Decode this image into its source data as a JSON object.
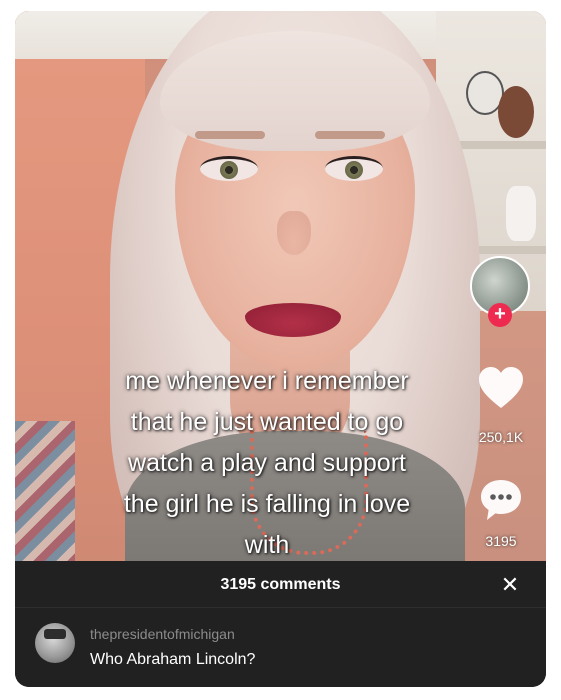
{
  "video": {
    "caption_lines": [
      "me whenever i remember",
      "that he just wanted to go",
      "watch a play and support",
      "the girl he is falling in love",
      "with"
    ]
  },
  "actions": {
    "follow_symbol": "+",
    "like_count": "250,1K",
    "comment_count": "3195",
    "icons": {
      "like": "heart-icon",
      "comment": "speech-bubble-icon",
      "follow": "plus-icon",
      "close": "close-icon"
    }
  },
  "comments_panel": {
    "title": "3195 comments",
    "close_symbol": "✕",
    "comments": [
      {
        "username": "thepresidentofmichigan",
        "text": "Who Abraham Lincoln?"
      }
    ]
  },
  "colors": {
    "accent_follow": "#ee2a50",
    "panel_bg": "#212121",
    "username": "#8c8c8c"
  }
}
